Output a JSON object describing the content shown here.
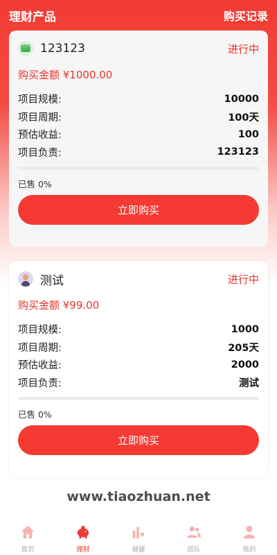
{
  "header": {
    "title": "理财产品",
    "link": "购买记录"
  },
  "products": [
    {
      "name": "123123",
      "status": "进行中",
      "amount": "购买金额 ¥1000.00",
      "rows": [
        {
          "k": "项目规模:",
          "v": "10000"
        },
        {
          "k": "项目周期:",
          "v": "100天"
        },
        {
          "k": "预估收益:",
          "v": "100"
        },
        {
          "k": "项目负责:",
          "v": "123123"
        }
      ],
      "progress_percent": 0,
      "sold": "已售 0%",
      "button": "立即购买",
      "avatar_icon": "green-image-icon"
    },
    {
      "name": "测试",
      "status": "进行中",
      "amount": "购买金额 ¥99.00",
      "rows": [
        {
          "k": "项目规模:",
          "v": "1000"
        },
        {
          "k": "项目周期:",
          "v": "205天"
        },
        {
          "k": "预估收益:",
          "v": "2000"
        },
        {
          "k": "项目负责:",
          "v": "测试"
        }
      ],
      "progress_percent": 0,
      "sold": "已售 0%",
      "button": "立即购买",
      "avatar_icon": "person-avatar-icon"
    }
  ],
  "watermark": "www.tiaozhuan.net",
  "tabbar": [
    {
      "label": "首页",
      "icon": "home-icon",
      "active": false
    },
    {
      "label": "理财",
      "icon": "piggy-bank-icon",
      "active": true
    },
    {
      "label": "健康",
      "icon": "health-chart-icon",
      "active": false
    },
    {
      "label": "团队",
      "icon": "team-icon",
      "active": false
    },
    {
      "label": "我的",
      "icon": "user-icon",
      "active": false
    }
  ],
  "colors": {
    "accent": "#f43a33",
    "tab_inactive": "#f5b3ae",
    "label_inactive": "#aaaaaa"
  }
}
